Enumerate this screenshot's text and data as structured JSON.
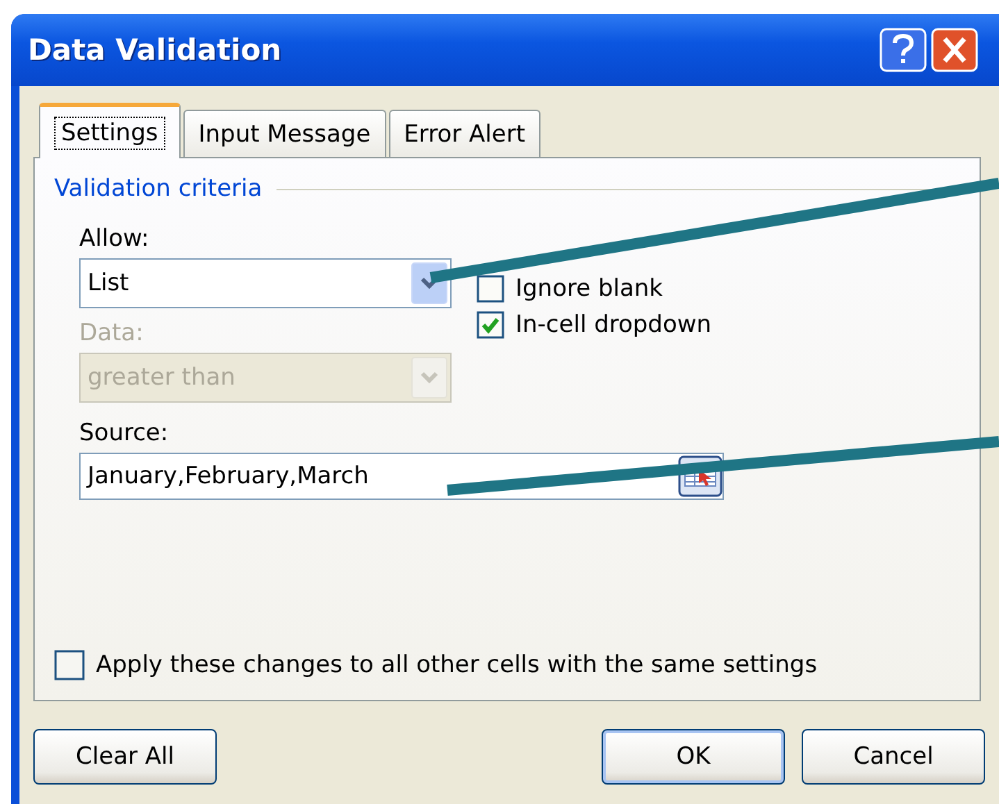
{
  "window": {
    "title": "Data Validation"
  },
  "tabs": [
    {
      "label": "Settings",
      "selected": true
    },
    {
      "label": "Input Message",
      "selected": false
    },
    {
      "label": "Error Alert",
      "selected": false
    }
  ],
  "group": {
    "title": "Validation criteria"
  },
  "allow": {
    "label": "Allow:",
    "value": "List",
    "disabled": false
  },
  "data": {
    "label": "Data:",
    "value": "greater than",
    "disabled": true
  },
  "options": [
    {
      "label": "Ignore blank",
      "checked": false
    },
    {
      "label": "In-cell dropdown",
      "checked": true
    }
  ],
  "source": {
    "label": "Source:",
    "value": "January,February,March"
  },
  "apply_all": {
    "label": "Apply these changes to all other cells with the same settings",
    "checked": false
  },
  "buttons": [
    {
      "label": "Clear All",
      "default": false
    },
    {
      "label": "OK",
      "default": true
    },
    {
      "label": "Cancel",
      "default": false
    }
  ]
}
